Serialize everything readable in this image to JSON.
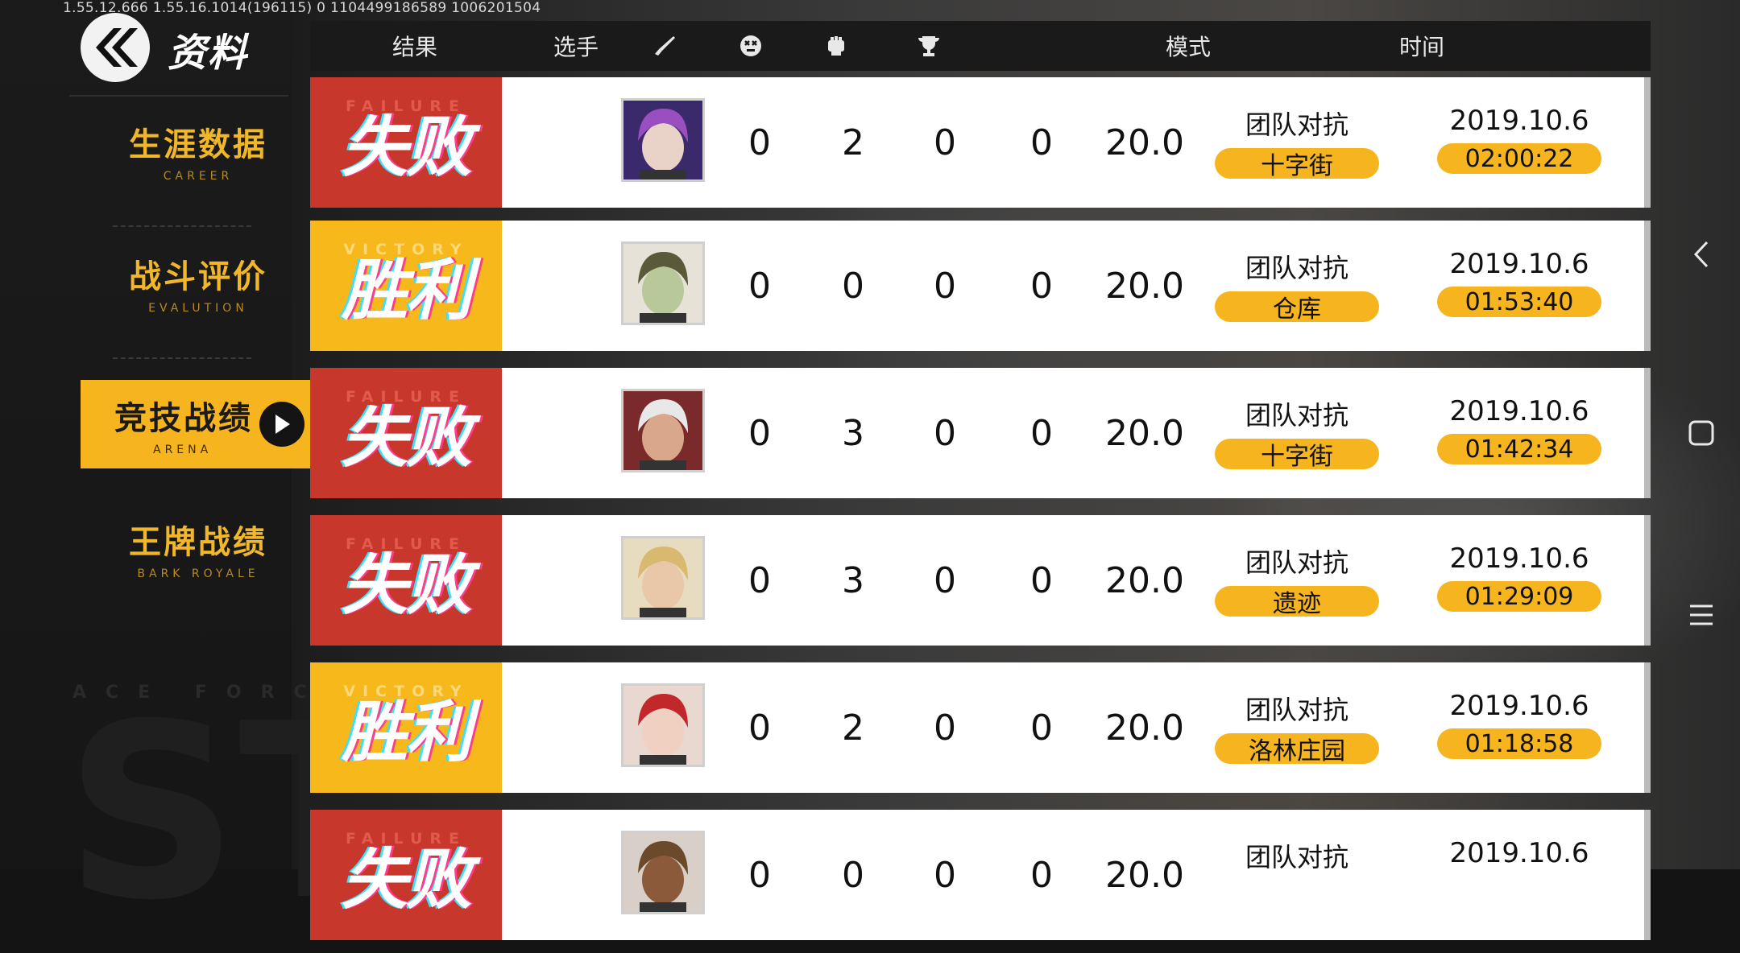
{
  "debug_line": "1.55.12.666  1.55.16.1014(196115)  0  1104499186589   1006201504",
  "page_title": "资料",
  "nav": [
    {
      "zh": "生涯数据",
      "en": "CAREER",
      "active": false
    },
    {
      "zh": "战斗评价",
      "en": "EVALUTION",
      "active": false
    },
    {
      "zh": "竞技战绩",
      "en": "ARENA",
      "active": true
    },
    {
      "zh": "王牌战绩",
      "en": "BARK ROYALE",
      "active": false
    }
  ],
  "watermark": {
    "en": "ACE FORCE",
    "big": "ST"
  },
  "header": {
    "result": "结果",
    "player": "选手",
    "kills_icon": "knife-icon",
    "deaths_icon": "skull-icon",
    "assists_icon": "fist-icon",
    "mvp_icon": "trophy-icon",
    "mode": "模式",
    "time": "时间"
  },
  "rows": [
    {
      "result": "fail",
      "result_en": "FAILURE",
      "result_zh": "失败",
      "avatar": "purple-hair",
      "kills": "0",
      "deaths": "2",
      "assists": "0",
      "mvp": "0",
      "score": "20.0",
      "mode": "团队对抗",
      "map": "十字街",
      "date": "2019.10.6",
      "time": "02:00:22"
    },
    {
      "result": "win",
      "result_en": "VICTORY",
      "result_zh": "胜利",
      "avatar": "joker",
      "kills": "0",
      "deaths": "0",
      "assists": "0",
      "mvp": "0",
      "score": "20.0",
      "mode": "团队对抗",
      "map": "仓库",
      "date": "2019.10.6",
      "time": "01:53:40"
    },
    {
      "result": "fail",
      "result_en": "FAILURE",
      "result_zh": "失败",
      "avatar": "old-captain",
      "kills": "0",
      "deaths": "3",
      "assists": "0",
      "mvp": "0",
      "score": "20.0",
      "mode": "团队对抗",
      "map": "十字街",
      "date": "2019.10.6",
      "time": "01:42:34"
    },
    {
      "result": "fail",
      "result_en": "FAILURE",
      "result_zh": "失败",
      "avatar": "blonde-officer",
      "kills": "0",
      "deaths": "3",
      "assists": "0",
      "mvp": "0",
      "score": "20.0",
      "mode": "团队对抗",
      "map": "遗迹",
      "date": "2019.10.6",
      "time": "01:29:09"
    },
    {
      "result": "win",
      "result_en": "VICTORY",
      "result_zh": "胜利",
      "avatar": "red-hair",
      "kills": "0",
      "deaths": "2",
      "assists": "0",
      "mvp": "0",
      "score": "20.0",
      "mode": "团队对抗",
      "map": "洛林庄园",
      "date": "2019.10.6",
      "time": "01:18:58"
    },
    {
      "result": "fail",
      "result_en": "FAILURE",
      "result_zh": "失败",
      "avatar": "dark-skin",
      "kills": "0",
      "deaths": "0",
      "assists": "0",
      "mvp": "0",
      "score": "20.0",
      "mode": "团队对抗",
      "map": "",
      "date": "2019.10.6",
      "time": ""
    }
  ],
  "colors": {
    "fail": "#c8372b",
    "win": "#f7b81c",
    "accent": "#f6b51e"
  },
  "system_nav": [
    "back-icon",
    "recents-icon",
    "menu-icon"
  ]
}
